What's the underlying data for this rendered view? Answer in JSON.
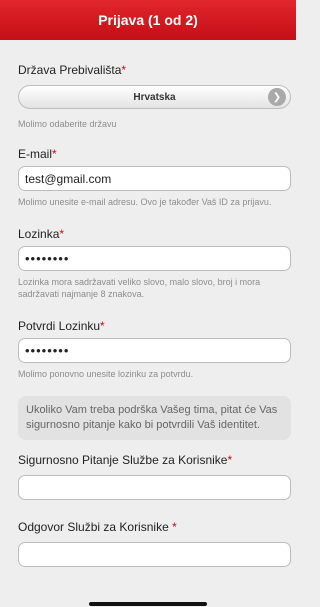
{
  "header": {
    "title": "Prijava (1 od 2)"
  },
  "country": {
    "label": "Država Prebivališta",
    "required_mark": "*",
    "value": "Hrvatska",
    "help": "Molimo odaberite državu"
  },
  "email": {
    "label": "E-mail",
    "required_mark": "*",
    "value": "test@gmail.com",
    "help": "Molimo unesite e-mail adresu. Ovo je također Vaš ID za prijavu."
  },
  "password": {
    "label": "Lozinka",
    "required_mark": "*",
    "value": "••••••••",
    "help": "Lozinka mora sadržavati veliko slovo, malo slovo, broj i mora sadržavati najmanje 8 znakova."
  },
  "confirm_password": {
    "label": "Potvrdi Lozinku",
    "required_mark": "*",
    "value": "••••••••",
    "help": "Molimo ponovno unesite lozinku za potvrdu."
  },
  "support_info": "Ukoliko Vam treba podrška Vašeg tima, pitat će Vas sigurnosno pitanje kako bi potvrdili Vaš identitet.",
  "security_question": {
    "label": "Sigurnosno Pitanje Službe za Korisnike",
    "required_mark": "*",
    "value": ""
  },
  "security_answer": {
    "label": "Odgovor Službi za Korisnike ",
    "required_mark": "*",
    "value": ""
  },
  "colors": {
    "accent": "#d41920",
    "required": "#d0021b"
  },
  "icons": {
    "select_arrow": "chevron-down-icon"
  }
}
